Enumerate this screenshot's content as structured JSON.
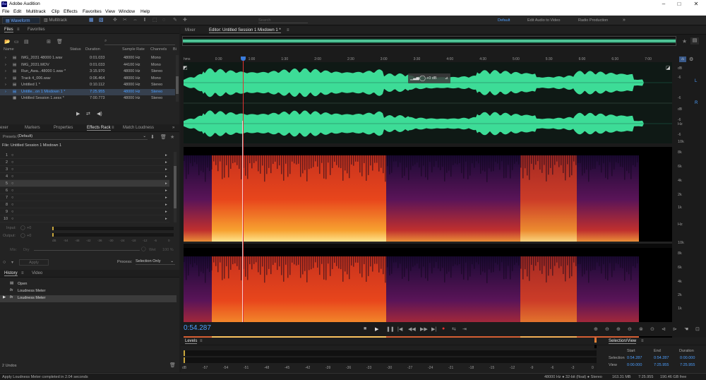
{
  "app": {
    "title": "Adobe Audition",
    "icon": "Au"
  },
  "menu": [
    "File",
    "Edit",
    "Multitrack",
    "Clip",
    "Effects",
    "Favorites",
    "View",
    "Window",
    "Help"
  ],
  "toolbar": {
    "waveform": "Waveform",
    "multitrack": "Multitrack",
    "workspaces": [
      "Default",
      "Edit Audio to Video",
      "Radio Production"
    ],
    "more": "»",
    "search_placeholder": "Search"
  },
  "files": {
    "tabs": [
      "Files",
      "Favorites"
    ],
    "columns": [
      "Name",
      "Status",
      "Duration",
      "Sample Rate",
      "Channels",
      "Bi"
    ],
    "rows": [
      {
        "name": "IMG_2031 48000 1.wav",
        "duration": "0:01.033",
        "rate": "48000 Hz",
        "channels": "Mono"
      },
      {
        "name": "IMG_2031.MOV",
        "duration": "0:01.033",
        "rate": "44100 Hz",
        "channels": "Mono"
      },
      {
        "name": "Run_Awa...48000 1.wav *",
        "duration": "3:15.970",
        "rate": "48000 Hz",
        "channels": "Stereo"
      },
      {
        "name": "Track 4_006.wav",
        "duration": "0:06.464",
        "rate": "48000 Hz",
        "channels": "Mono"
      },
      {
        "name": "Untitled 1 *",
        "duration": "0:10.112",
        "rate": "48000 Hz",
        "channels": "Stereo"
      },
      {
        "name": "Untitle...on 1 Mixdown 1 *",
        "duration": "7:25.955",
        "rate": "48000 Hz",
        "channels": "Stereo"
      },
      {
        "name": "Untitled Session 1.sesx *",
        "duration": "7:00.773",
        "rate": "48000 Hz",
        "channels": "Stereo"
      }
    ]
  },
  "effects": {
    "tabs": [
      "exer",
      "Markers",
      "Properties",
      "Effects Rack",
      "Match Loudness"
    ],
    "presets_label": "Presets:",
    "preset_value": "(Default)",
    "file_label": "File: Untitled Session 1 Mixdown 1",
    "slots": [
      "1",
      "2",
      "3",
      "4",
      "5",
      "6",
      "7",
      "8",
      "9",
      "10"
    ],
    "input_label": "Input:",
    "input_value": "+0",
    "output_label": "Output:",
    "output_value": "+0",
    "meter_scale": [
      "dB",
      "-54",
      "-48",
      "-42",
      "-36",
      "-30",
      "-24",
      "-18",
      "-12",
      "-6",
      "0"
    ],
    "mix_label": "Mix:",
    "dry_label": "Dry",
    "wet_label": "Wet",
    "wet_value": "100 %",
    "apply": "Apply",
    "process_label": "Process:",
    "process_value": "Selection Only"
  },
  "history": {
    "tabs": [
      "History",
      "Video"
    ],
    "items": [
      "Open",
      "Loudness Meter",
      "Loudness Meter"
    ],
    "undos": "2 Undos"
  },
  "editor": {
    "tabs": [
      "Mixer",
      "Editor: Untitled Session 1 Mixdown 1 *"
    ],
    "hud_level": "+0 dB",
    "ruler": [
      "hms",
      "0:30",
      "1:00",
      "1:30",
      "2:00",
      "2:30",
      "3:00",
      "3:30",
      "4:00",
      "4:30",
      "5:00",
      "5:30",
      "6:00",
      "6:30",
      "7:00"
    ],
    "db_labels": [
      "dB",
      "-6",
      "-6",
      "dB",
      "-6",
      "-6"
    ],
    "channel_labels": [
      "L",
      "R"
    ],
    "hz_labels": [
      "Hz",
      "10k",
      "8k",
      "6k",
      "4k",
      "2k",
      "1k"
    ],
    "playhead_fraction": 0.122
  },
  "transport": {
    "timecode": "0:54.287"
  },
  "levels": {
    "title": "Levels",
    "scale": [
      "dB",
      "-57",
      "-54",
      "-51",
      "-48",
      "-45",
      "-42",
      "-39",
      "-36",
      "-33",
      "-30",
      "-27",
      "-24",
      "-21",
      "-18",
      "-15",
      "-12",
      "-9",
      "-6",
      "-3",
      "0"
    ]
  },
  "selection_view": {
    "title": "Selection/View",
    "headers": [
      "Start",
      "End",
      "Duration"
    ],
    "selection": {
      "label": "Selection",
      "start": "0:54.287",
      "end": "0:54.287",
      "duration": "0:00.000"
    },
    "view": {
      "label": "View",
      "start": "0:00.000",
      "end": "7:25.955",
      "duration": "7:25.955"
    }
  },
  "status": {
    "left": "Apply Loudness Meter completed in 2.04 seconds",
    "format": "48000 Hz ● 32-bit (float) ● Stereo",
    "size": "163.31 MB",
    "duration": "7:25.955",
    "free": "190.46 GB free"
  },
  "colors": {
    "accent": "#4d9fff",
    "waveform": "#3ddc97",
    "playhead": "#e03131"
  }
}
